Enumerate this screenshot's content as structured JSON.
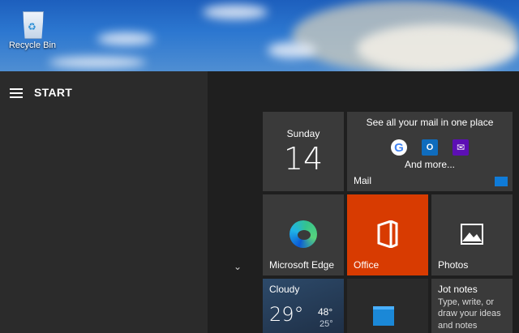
{
  "desktop": {
    "recycle_bin_label": "Recycle Bin"
  },
  "start_menu": {
    "title": "START",
    "tiles": {
      "calendar": {
        "day_name": "Sunday",
        "day_number": "14"
      },
      "mail": {
        "headline": "See all your mail in one place",
        "providers": [
          "google-icon",
          "outlook-icon",
          "yahoo-mail-icon"
        ],
        "more_text": "And more...",
        "label": "Mail"
      },
      "edge": {
        "label": "Microsoft Edge"
      },
      "office": {
        "label": "Office",
        "color": "#d83b01"
      },
      "photos": {
        "label": "Photos"
      },
      "weather": {
        "condition": "Cloudy",
        "temp": "29°",
        "high": "48°",
        "low": "25°"
      },
      "todo": {
        "icon": "todo-icon"
      },
      "jot_notes": {
        "title": "Jot notes",
        "description": "Type, write, or draw your ideas and notes"
      }
    }
  }
}
